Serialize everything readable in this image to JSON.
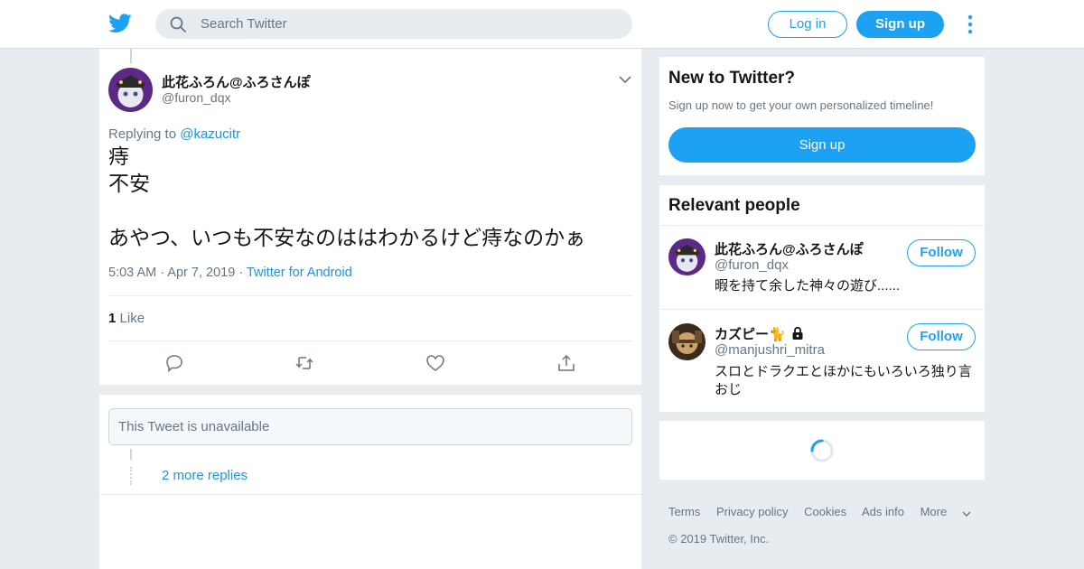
{
  "topbar": {
    "search_placeholder": "Search Twitter",
    "login_label": "Log in",
    "signup_label": "Sign up"
  },
  "tweet": {
    "author_name": "此花ふろん@ふろさんぽ",
    "author_handle": "@furon_dqx",
    "replying_prefix": "Replying to",
    "replying_to": "@kazucitr",
    "text": "痔\n不安\n\nあやつ、いつも不安なのははわかるけど痔なのかぁ",
    "time": "5:03 AM",
    "date": "Apr 7, 2019",
    "source": "Twitter for Android",
    "like_count": "1",
    "like_label": "Like"
  },
  "replies": {
    "unavailable_text": "This Tweet is unavailable",
    "more_replies_label": "2 more replies"
  },
  "sidebar": {
    "new_title": "New to Twitter?",
    "new_subtitle": "Sign up now to get your own personalized timeline!",
    "signup_label": "Sign up",
    "people_title": "Relevant people",
    "people": [
      {
        "name": "此花ふろん@ふろさんぽ",
        "handle": "@furon_dqx",
        "bio": "暇を持て余した神々の遊び......",
        "follow_label": "Follow"
      },
      {
        "name": "カズピー🐈",
        "handle": "@manjushri_mitra",
        "bio": "スロとドラクエとほかにもいろいろ独り言おじ",
        "follow_label": "Follow"
      }
    ]
  },
  "footer": {
    "links": [
      "Terms",
      "Privacy policy",
      "Cookies",
      "Ads info",
      "More"
    ],
    "copyright": "© 2019 Twitter, Inc."
  },
  "colors": {
    "accent": "#1da1f2",
    "link": "#1b95e0",
    "background": "#e6ecf0"
  }
}
